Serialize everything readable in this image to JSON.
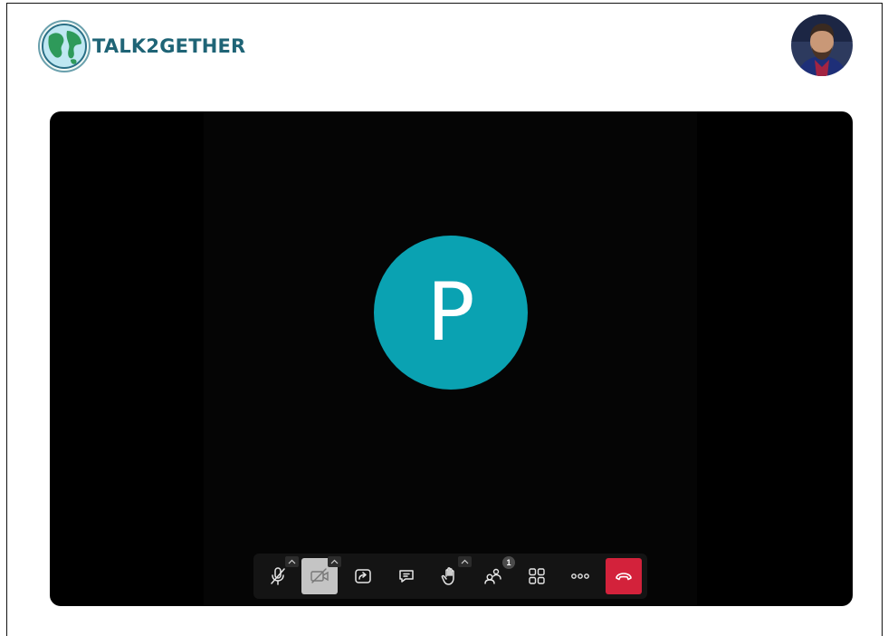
{
  "brand": {
    "name": "TALK2GETHER",
    "logo_icon": "globe-icon"
  },
  "user": {
    "avatar_icon": "user-avatar"
  },
  "participant": {
    "initial": "P",
    "color": "#0aa2b2"
  },
  "toolbar": {
    "buttons": [
      {
        "name": "microphone",
        "icon": "mic-off-icon",
        "state": "muted"
      },
      {
        "name": "camera",
        "icon": "camera-off-icon",
        "state": "off"
      },
      {
        "name": "share-screen",
        "icon": "share-screen-icon"
      },
      {
        "name": "chat",
        "icon": "chat-icon"
      },
      {
        "name": "raise-hand",
        "icon": "hand-icon"
      },
      {
        "name": "participants",
        "icon": "participants-icon"
      },
      {
        "name": "layout",
        "icon": "grid-icon"
      },
      {
        "name": "more",
        "icon": "more-icon"
      },
      {
        "name": "leave-call",
        "icon": "hangup-icon"
      }
    ],
    "participants_count": "1"
  },
  "colors": {
    "brand": "#1f6476",
    "hangup": "#d3223b",
    "stage": "#000000"
  }
}
